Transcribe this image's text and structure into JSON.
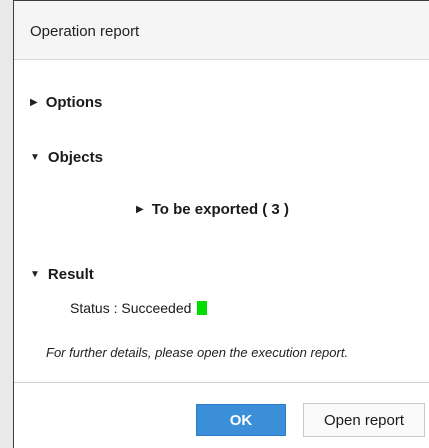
{
  "window": {
    "title": "Operation report"
  },
  "sections": {
    "options": {
      "label": "Options",
      "expanded": false
    },
    "objects": {
      "label": "Objects",
      "expanded": true
    },
    "to_be_exported": {
      "label": "To be exported ( 3 )",
      "expanded": false
    },
    "result": {
      "label": "Result",
      "expanded": true
    }
  },
  "result": {
    "status_text": "Status : Succeeded",
    "status_color": "#00dd00"
  },
  "note": "For further details, please open the execution report.",
  "buttons": {
    "ok": "OK",
    "open_report": "Open report"
  },
  "icons": {
    "collapsed": "▶",
    "expanded": "▼"
  }
}
